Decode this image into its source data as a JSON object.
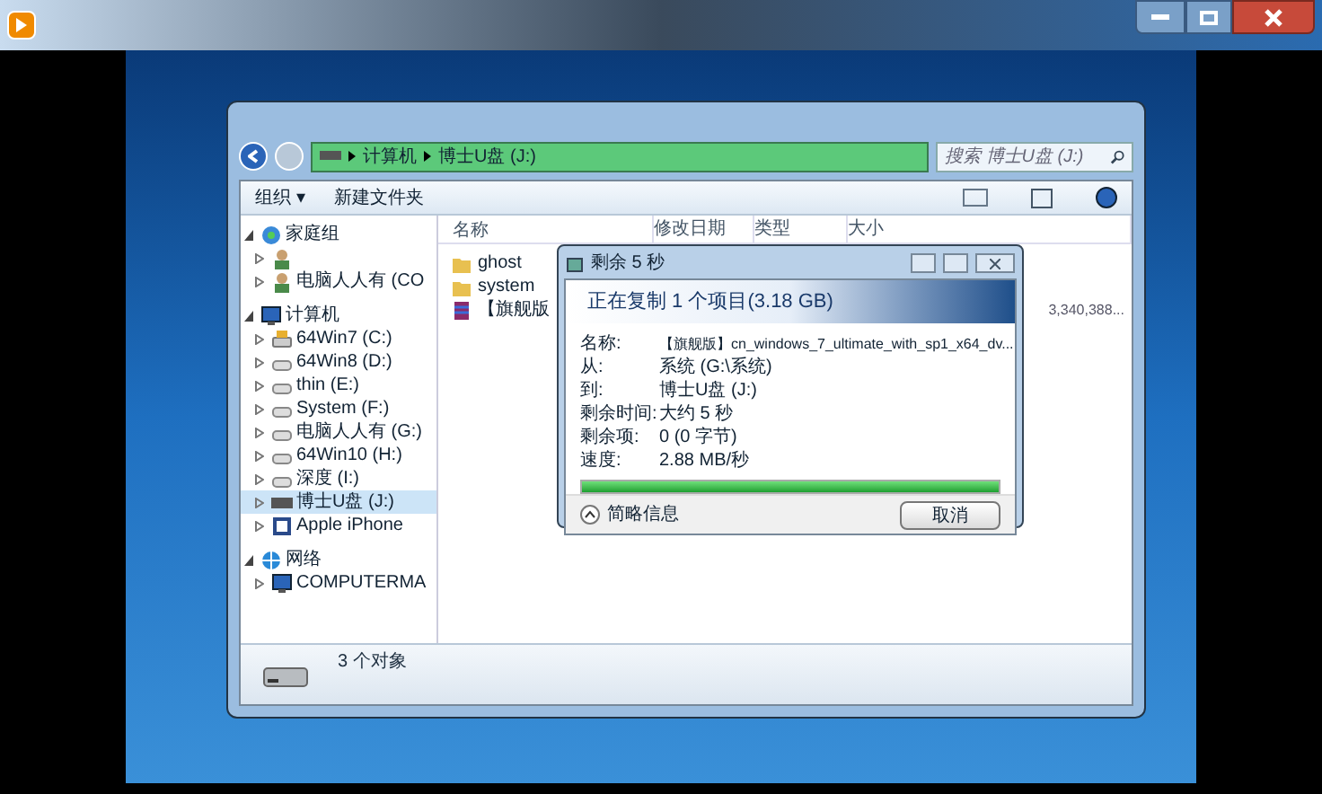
{
  "address_bar": {
    "segments": [
      "计算机",
      "博士U盘 (J:)"
    ]
  },
  "search": {
    "placeholder": "搜索 博士U盘 (J:)"
  },
  "toolbar": {
    "buttons": [
      "组织 ▾",
      "新建文件夹"
    ]
  },
  "columns": [
    "名称",
    "修改日期",
    "类型",
    "大小"
  ],
  "nav_tree": [
    {
      "label": "家庭组",
      "kind": "homegroup",
      "expanded": true,
      "selected": false,
      "children": [
        {
          "kind": "user",
          "expanded": false,
          "selected": false
        },
        {
          "label": "电脑人人有 (CO",
          "kind": "user",
          "expanded": false,
          "selected": false
        }
      ]
    },
    {
      "label": "计算机",
      "kind": "computer",
      "expanded": true,
      "selected": false,
      "children": [
        {
          "label": "64Win7  (C:)",
          "kind": "system-drive",
          "expanded": false,
          "selected": false
        },
        {
          "label": "64Win8  (D:)",
          "kind": "drive",
          "expanded": false,
          "selected": false
        },
        {
          "label": "thin (E:)",
          "kind": "drive",
          "expanded": false,
          "selected": false
        },
        {
          "label": "System (F:)",
          "kind": "drive",
          "expanded": false,
          "selected": false
        },
        {
          "label": "电脑人人有 (G:)",
          "kind": "drive",
          "expanded": false,
          "selected": false
        },
        {
          "label": "64Win10 (H:)",
          "kind": "drive",
          "expanded": false,
          "selected": false
        },
        {
          "label": "深度 (I:)",
          "kind": "drive",
          "expanded": false,
          "selected": false
        },
        {
          "label": "博士U盘 (J:)",
          "kind": "usb",
          "expanded": false,
          "selected": true
        },
        {
          "label": "Apple iPhone",
          "kind": "phone",
          "expanded": false,
          "selected": false
        }
      ]
    },
    {
      "label": "网络",
      "kind": "network",
      "expanded": true,
      "selected": false,
      "children": [
        {
          "label": "COMPUTERMA",
          "kind": "computer",
          "expanded": false,
          "selected": false
        }
      ]
    }
  ],
  "files": [
    {
      "name": "ghost",
      "kind": "folder"
    },
    {
      "name": "system",
      "kind": "folder"
    },
    {
      "name": "【旗舰版",
      "kind": "archive",
      "size": "3,340,388..."
    }
  ],
  "status_bar": {
    "text": "3 个对象"
  },
  "copy_dialog": {
    "title": "剩余 5 秒",
    "heading": "正在复制 1 个项目(3.18 GB)",
    "fields": [
      {
        "label": "名称:",
        "value": "【旗舰版】cn_windows_7_ultimate_with_sp1_x64_dv..."
      },
      {
        "label": "从:",
        "value": "系统 (G:\\系统)"
      },
      {
        "label": "到:",
        "value": "博士U盘 (J:)"
      },
      {
        "label": "剩余时间:",
        "value": "大约 5 秒"
      },
      {
        "label": "剩余项:",
        "value": "0 (0 字节)"
      },
      {
        "label": "速度:",
        "value": "2.88 MB/秒"
      }
    ],
    "progress": {
      "level": 1.0
    },
    "details_toggle": "简略信息",
    "cancel_button": "取消"
  }
}
